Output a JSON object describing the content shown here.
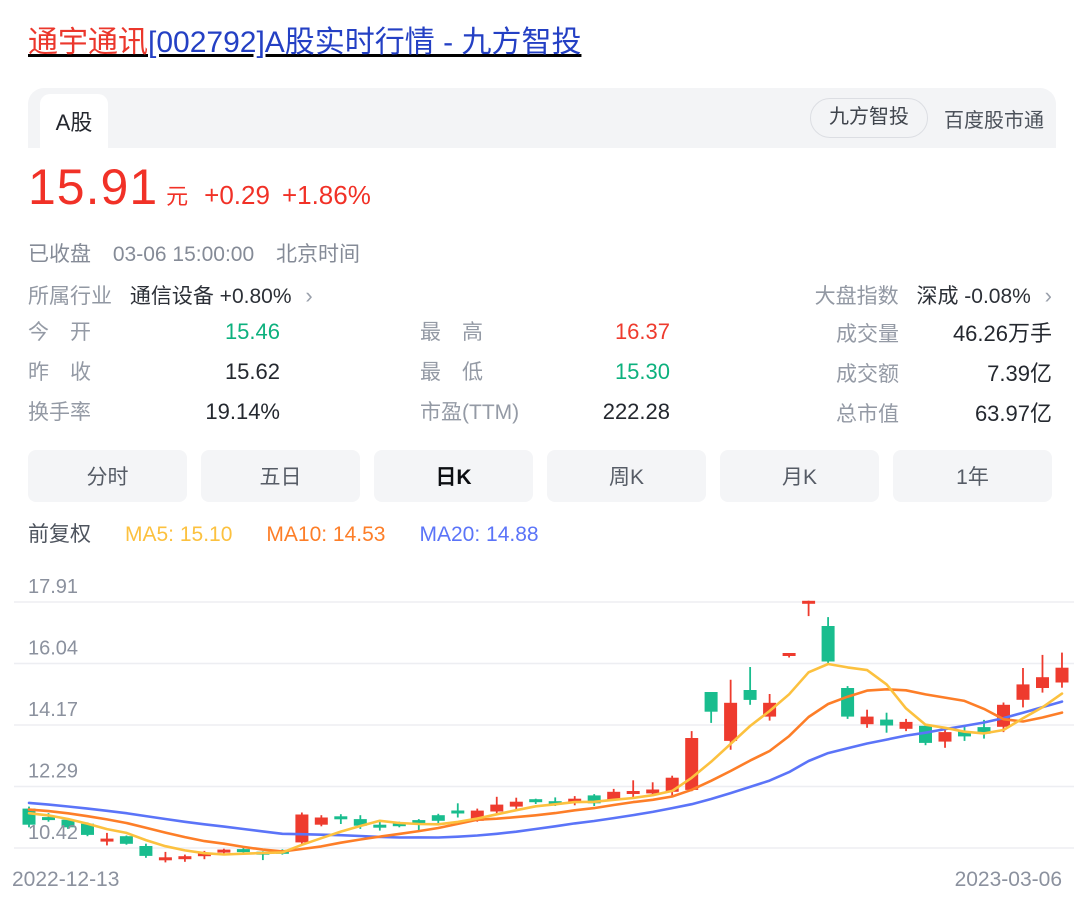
{
  "page_title": {
    "stock_name": "通宇通讯",
    "rest": "[002792]A股实时行情 - 九方智投"
  },
  "tabbar": {
    "active_tab": "A股",
    "badge_pill": "九方智投",
    "badge_plain": "百度股市通"
  },
  "quote": {
    "price": "15.91",
    "unit": "元",
    "change": "+0.29",
    "change_pct": "+1.86%",
    "market_status": "已收盘",
    "time": "03-06 15:00:00",
    "timezone": "北京时间"
  },
  "industry": {
    "label": "所属行业",
    "value": "通信设备 +0.80%",
    "chevron": "›"
  },
  "market_index": {
    "label": "大盘指数",
    "value": "深成 -0.08%",
    "chevron": "›"
  },
  "stats_columns": [
    [
      {
        "label": "今　开",
        "value": "15.46",
        "color": "#0db17e"
      },
      {
        "label": "昨　收",
        "value": "15.62",
        "color": "#24282f"
      },
      {
        "label": "换手率",
        "value": "19.14%",
        "color": "#24282f"
      }
    ],
    [
      {
        "label": "最　高",
        "value": "16.37",
        "color": "#ee3b2e"
      },
      {
        "label": "最　低",
        "value": "15.30",
        "color": "#0db17e"
      },
      {
        "label": "市盈(TTM)",
        "value": "222.28",
        "color": "#24282f"
      }
    ],
    [
      {
        "label": "成交量",
        "value": "46.26万手",
        "color": "#24282f"
      },
      {
        "label": "成交额",
        "value": "7.39亿",
        "color": "#24282f"
      },
      {
        "label": "总市值",
        "value": "63.97亿",
        "color": "#24282f"
      }
    ]
  ],
  "period_tabs": [
    "分时",
    "五日",
    "日K",
    "周K",
    "月K",
    "1年"
  ],
  "active_period": "日K",
  "chart_legend": {
    "adjust": "前复权",
    "ma5": "MA5: 15.10",
    "ma10": "MA10: 14.53",
    "ma20": "MA20: 14.88"
  },
  "chart_data": {
    "type": "candlestick",
    "title": "通宇通讯 日K 前复权",
    "legend": [
      {
        "name": "MA5",
        "value": 15.1,
        "color": "#fcc13f"
      },
      {
        "name": "MA10",
        "value": 14.53,
        "color": "#fd7e28"
      },
      {
        "name": "MA20",
        "value": 14.88,
        "color": "#5b74f8"
      }
    ],
    "y_axis": {
      "ticks": [
        "17.91",
        "16.04",
        "14.17",
        "12.29",
        "10.42"
      ],
      "range": [
        10.42,
        17.91
      ]
    },
    "x_axis": {
      "start": "2022-12-13",
      "end": "2023-03-06"
    },
    "colors": {
      "up": "#ee3b2e",
      "down": "#19bd8e",
      "ma5": "#fcc13f",
      "ma10": "#fd7e28",
      "ma20": "#5b74f8",
      "grid": "#edeef2"
    },
    "candles": [
      [
        "12-13",
        11.62,
        11.68,
        11.05,
        11.13
      ],
      [
        "12-14",
        11.35,
        11.48,
        11.22,
        11.28
      ],
      [
        "12-15",
        11.28,
        11.32,
        11.0,
        11.05
      ],
      [
        "12-16",
        11.16,
        11.2,
        10.78,
        10.82
      ],
      [
        "12-19",
        10.62,
        10.88,
        10.5,
        10.7
      ],
      [
        "12-20",
        10.78,
        10.8,
        10.52,
        10.55
      ],
      [
        "12-21",
        10.48,
        10.55,
        10.12,
        10.18
      ],
      [
        "12-22",
        10.05,
        10.3,
        9.98,
        10.13
      ],
      [
        "12-23",
        10.08,
        10.22,
        10.0,
        10.17
      ],
      [
        "12-26",
        10.17,
        10.33,
        10.08,
        10.28
      ],
      [
        "12-27",
        10.3,
        10.4,
        10.22,
        10.35
      ],
      [
        "12-28",
        10.38,
        10.42,
        10.25,
        10.3
      ],
      [
        "12-29",
        10.28,
        10.32,
        10.05,
        10.24
      ],
      [
        "12-30",
        10.32,
        10.38,
        10.22,
        10.26
      ],
      [
        "01-03",
        10.59,
        11.5,
        10.55,
        11.44
      ],
      [
        "01-04",
        11.13,
        11.42,
        11.08,
        11.35
      ],
      [
        "01-05",
        11.38,
        11.45,
        11.15,
        11.3
      ],
      [
        "01-06",
        11.3,
        11.42,
        11.0,
        11.1
      ],
      [
        "01-09",
        11.12,
        11.25,
        10.95,
        11.05
      ],
      [
        "01-10",
        11.16,
        11.22,
        11.05,
        11.1
      ],
      [
        "01-11",
        11.25,
        11.3,
        10.92,
        11.2
      ],
      [
        "01-12",
        11.42,
        11.46,
        11.18,
        11.25
      ],
      [
        "01-13",
        11.55,
        11.78,
        11.35,
        11.48
      ],
      [
        "01-16",
        11.25,
        11.62,
        11.22,
        11.56
      ],
      [
        "01-17",
        11.53,
        11.98,
        11.48,
        11.74
      ],
      [
        "01-18",
        11.68,
        11.95,
        11.6,
        11.83
      ],
      [
        "01-19",
        11.88,
        11.92,
        11.76,
        11.84
      ],
      [
        "01-20",
        11.82,
        11.96,
        11.7,
        11.78
      ],
      [
        "01-30",
        11.85,
        12.0,
        11.72,
        11.9
      ],
      [
        "01-31",
        12.02,
        12.06,
        11.7,
        11.78
      ],
      [
        "02-01",
        11.89,
        12.22,
        11.85,
        12.13
      ],
      [
        "02-02",
        12.1,
        12.48,
        11.95,
        12.12
      ],
      [
        "02-03",
        12.08,
        12.42,
        12.0,
        12.2
      ],
      [
        "02-06",
        12.13,
        12.62,
        11.98,
        12.56
      ],
      [
        "02-07",
        12.19,
        13.98,
        12.15,
        13.77
      ],
      [
        "02-08",
        15.17,
        15.17,
        14.23,
        14.57
      ],
      [
        "02-09",
        13.68,
        15.54,
        13.41,
        14.84
      ],
      [
        "02-10",
        15.23,
        15.93,
        14.78,
        14.93
      ],
      [
        "02-13",
        14.42,
        15.11,
        14.3,
        14.84
      ],
      [
        "02-14",
        16.3,
        16.33,
        16.22,
        16.32
      ],
      [
        "02-15",
        17.88,
        17.95,
        17.48,
        17.92
      ],
      [
        "02-16",
        17.18,
        17.45,
        16.02,
        16.1
      ],
      [
        "02-17",
        15.29,
        15.35,
        14.35,
        14.42
      ],
      [
        "02-20",
        14.19,
        14.63,
        14.08,
        14.42
      ],
      [
        "02-21",
        14.33,
        14.54,
        13.93,
        14.15
      ],
      [
        "02-22",
        14.05,
        14.35,
        13.98,
        14.26
      ],
      [
        "02-23",
        14.14,
        14.2,
        13.55,
        13.62
      ],
      [
        "02-24",
        13.66,
        14.02,
        13.47,
        13.95
      ],
      [
        "02-27",
        13.98,
        14.12,
        13.68,
        13.82
      ],
      [
        "02-28",
        14.1,
        14.32,
        13.75,
        13.9
      ],
      [
        "03-01",
        14.11,
        14.85,
        13.95,
        14.78
      ],
      [
        "03-02",
        14.93,
        15.9,
        14.7,
        15.4
      ],
      [
        "03-03",
        15.29,
        16.3,
        15.15,
        15.62
      ],
      [
        "03-06",
        15.46,
        16.37,
        15.3,
        15.91
      ]
    ]
  }
}
